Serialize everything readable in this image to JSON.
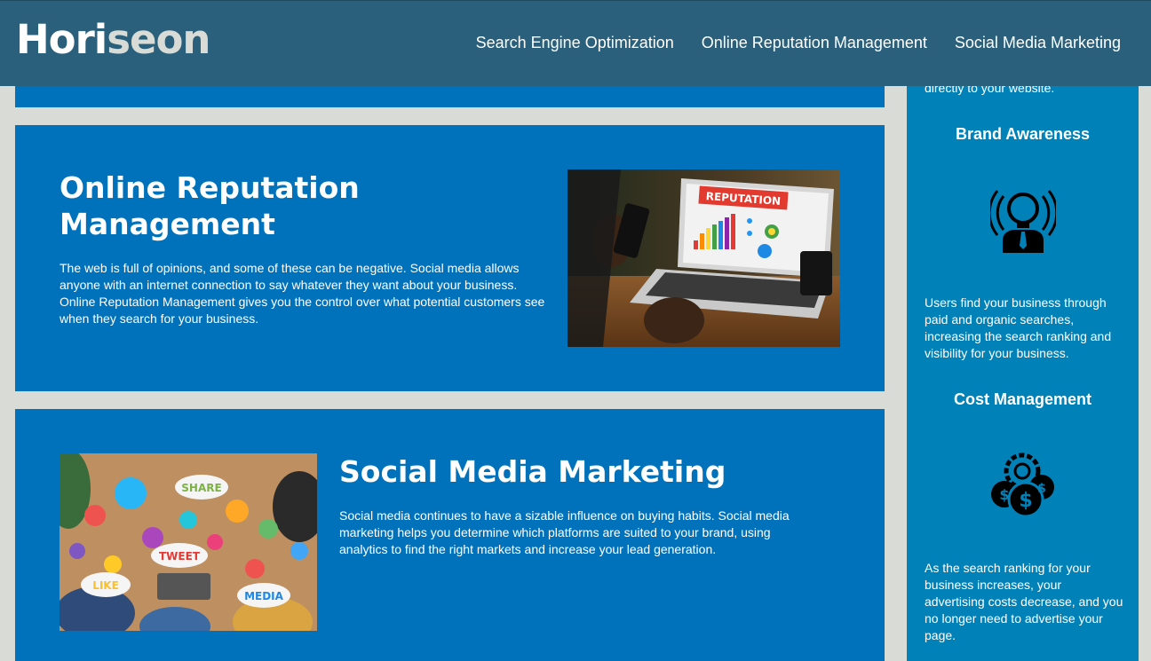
{
  "header": {
    "logo_main": "Hori",
    "logo_accent": "seon",
    "nav": [
      {
        "label": "Search Engine Optimization"
      },
      {
        "label": "Online Reputation Management"
      },
      {
        "label": "Social Media Marketing"
      }
    ]
  },
  "cards": {
    "orm": {
      "title": "Online Reputation Management",
      "body": "The web is full of opinions, and some of these can be negative. Social media allows anyone with an internet connection to say whatever they want about your business. Online Reputation Management gives you the control over what potential customers see when they search for your business.",
      "image_label": "REPUTATION"
    },
    "smm": {
      "title": "Social Media Marketing",
      "body": "Social media continues to have a sizable influence on buying habits. Social media marketing helps you determine which platforms are suited to your brand, using analytics to find the right markets and increase your lead generation.",
      "image_words": {
        "share": "SHARE",
        "tweet": "TWEET",
        "like": "LIKE",
        "media": "MEDIA"
      }
    }
  },
  "sidebar": {
    "fragment": "directly to your website.",
    "brand": {
      "title": "Brand Awareness",
      "body": "Users find your business through paid and organic searches, increasing the search ranking and visibility for your business.",
      "icon": "lightbulb-person-icon"
    },
    "cost": {
      "title": "Cost Management",
      "body": "As the search ranking for your business increases, your advertising costs decrease, and you no longer need to advertise your page.",
      "icon": "gear-coins-icon"
    }
  },
  "colors": {
    "header_bg": "#2a607c",
    "card_bg": "#0072bb",
    "sidebar_bg": "#0082b8",
    "page_bg": "#d9dcd6"
  }
}
